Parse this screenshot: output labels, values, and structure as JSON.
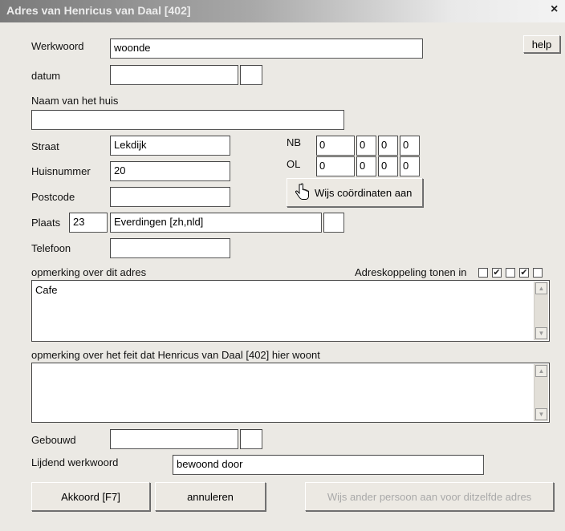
{
  "window": {
    "title": "Adres van Henricus van Daal [402]",
    "close": "×"
  },
  "help_label": "help",
  "werkwoord": {
    "label": "Werkwoord",
    "value": "woonde"
  },
  "datum": {
    "label": "datum",
    "value": "",
    "extra": ""
  },
  "huisnaam": {
    "label": "Naam van het huis",
    "value": ""
  },
  "straat": {
    "label": "Straat",
    "value": "Lekdijk"
  },
  "huisnummer": {
    "label": "Huisnummer",
    "value": "20"
  },
  "postcode": {
    "label": "Postcode",
    "value": ""
  },
  "plaats": {
    "label": "Plaats",
    "code": "23",
    "value": "Everdingen [zh,nld]",
    "extra": ""
  },
  "telefoon": {
    "label": "Telefoon",
    "value": ""
  },
  "nb": {
    "label": "NB",
    "values": [
      "0",
      "0",
      "0",
      "0"
    ]
  },
  "ol": {
    "label": "OL",
    "values": [
      "0",
      "0",
      "0",
      "0"
    ]
  },
  "coord_button": "Wijs coördinaten aan",
  "opmerking_adres": {
    "label": "opmerking over dit adres",
    "value": "Cafe"
  },
  "adreskoppeling": {
    "label": "Adreskoppeling tonen in",
    "checks": [
      false,
      true,
      false,
      true,
      false
    ]
  },
  "opmerking_feit": {
    "label": "opmerking over het feit dat Henricus van Daal [402] hier woont",
    "value": ""
  },
  "gebouwd": {
    "label": "Gebouwd",
    "value": "",
    "extra": ""
  },
  "lijdend": {
    "label": "Lijdend werkwoord",
    "value": "bewoond door"
  },
  "buttons": {
    "akkoord": "Akkoord [F7]",
    "annuleren": "annuleren",
    "wijs_ander": "Wijs ander persoon aan voor ditzelfde adres"
  },
  "colors": {
    "titlebar_start": "#7a7a7a",
    "titlebar_end": "#f4f4f4",
    "dialog_bg": "#ebe9e4",
    "disabled_text": "#a9a9a9"
  }
}
